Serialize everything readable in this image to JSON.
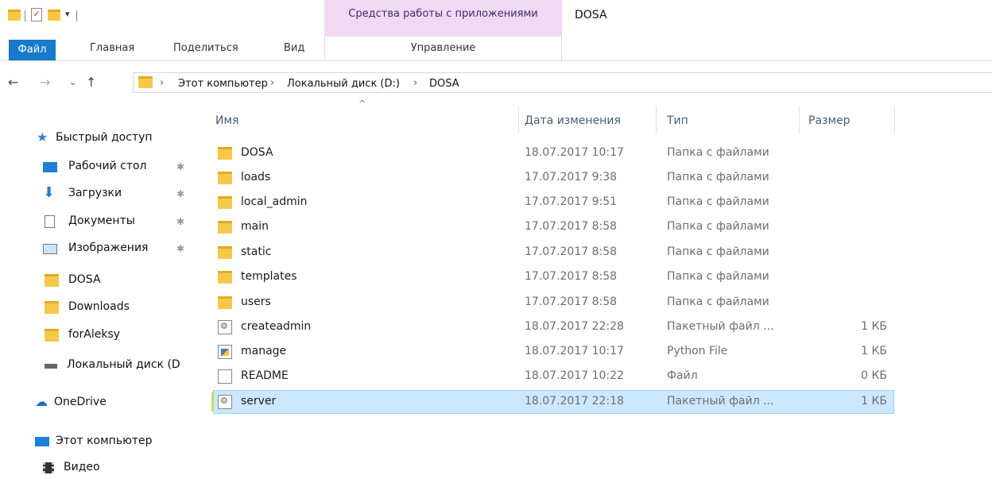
{
  "window": {
    "title": "DOSA",
    "context_tools": "Средства работы с приложениями"
  },
  "ribbon": {
    "tabs": [
      "Файл",
      "Главная",
      "Поделиться",
      "Вид",
      "Управление"
    ]
  },
  "address": {
    "crumbs": [
      "Этот компьютер",
      "Локальный диск (D:)",
      "DOSA"
    ]
  },
  "nav_pane": {
    "quick_access": "Быстрый доступ",
    "items": [
      "Рабочий стол",
      "Загрузки",
      "Документы",
      "Изображения",
      "DOSA",
      "Downloads",
      "forAleksy",
      "Локальный диск (D"
    ],
    "onedrive": "OneDrive",
    "this_pc": "Этот компьютер",
    "video": "Видео"
  },
  "columns": [
    "Имя",
    "Дата изменения",
    "Тип",
    "Размер"
  ],
  "rows": [
    {
      "name": "DOSA",
      "date": "18.07.2017 10:17",
      "type": "Папка с файлами",
      "size": "",
      "icon": "folder-icon"
    },
    {
      "name": "loads",
      "date": "17.07.2017 9:38",
      "type": "Папка с файлами",
      "size": "",
      "icon": "folder-icon"
    },
    {
      "name": "local_admin",
      "date": "17.07.2017 9:51",
      "type": "Папка с файлами",
      "size": "",
      "icon": "folder-icon"
    },
    {
      "name": "main",
      "date": "17.07.2017 8:58",
      "type": "Папка с файлами",
      "size": "",
      "icon": "folder-icon"
    },
    {
      "name": "static",
      "date": "17.07.2017 8:58",
      "type": "Папка с файлами",
      "size": "",
      "icon": "folder-icon"
    },
    {
      "name": "templates",
      "date": "17.07.2017 8:58",
      "type": "Папка с файлами",
      "size": "",
      "icon": "folder-icon"
    },
    {
      "name": "users",
      "date": "17.07.2017 8:58",
      "type": "Папка с файлами",
      "size": "",
      "icon": "folder-icon"
    },
    {
      "name": "createadmin",
      "date": "18.07.2017 22:28",
      "type": "Пакетный файл ...",
      "size": "1 КБ",
      "icon": "batch-file-icon"
    },
    {
      "name": "manage",
      "date": "18.07.2017 10:17",
      "type": "Python File",
      "size": "1 КБ",
      "icon": "python-file-icon"
    },
    {
      "name": "README",
      "date": "18.07.2017 10:22",
      "type": "Файл",
      "size": "0 КБ",
      "icon": "file-icon"
    },
    {
      "name": "server",
      "date": "18.07.2017 22:18",
      "type": "Пакетный файл ...",
      "size": "1 КБ",
      "icon": "batch-file-icon"
    }
  ],
  "colors": {
    "accent": "#1979ca",
    "selection": "#cce8ff",
    "highlight": "#c9ef00",
    "context_tab": "#f2d9f3"
  }
}
